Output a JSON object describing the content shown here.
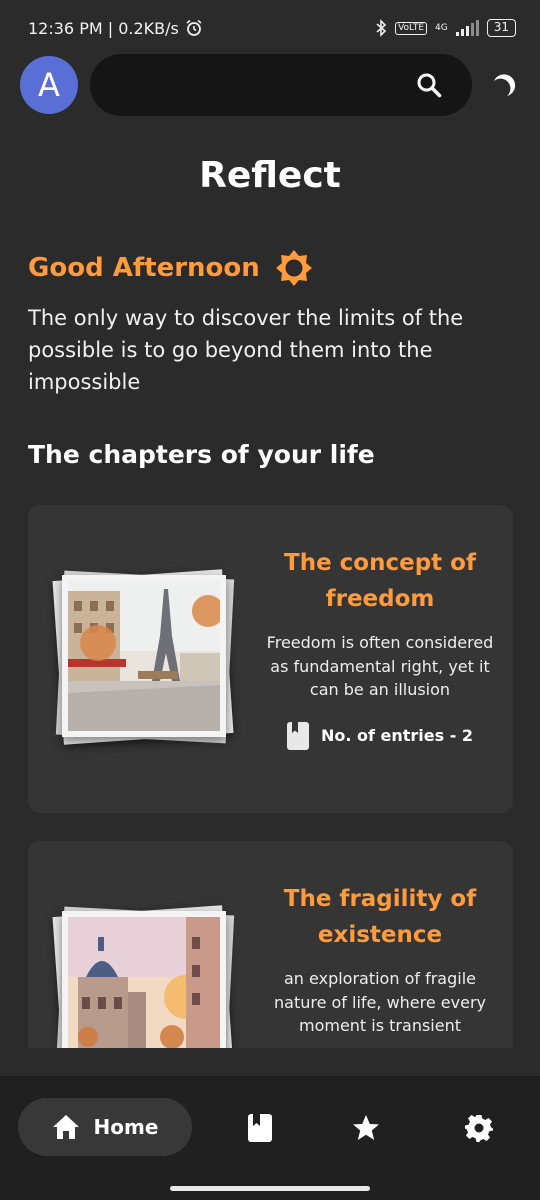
{
  "status_bar": {
    "time_speed": "12:36 PM | 0.2KB/s",
    "alarm_icon": "alarm-icon",
    "bluetooth_icon": "bluetooth-icon",
    "volte": "VoLTE",
    "network": "4G",
    "battery": "31"
  },
  "top_bar": {
    "avatar_letter": "A",
    "search_placeholder": "",
    "search_icon": "search-icon",
    "theme_icon": "moon-icon"
  },
  "page": {
    "title": "Reflect",
    "greeting": "Good Afternoon",
    "greeting_icon": "sun-icon",
    "quote": "The only way to discover the limits of the possible is to go beyond them into the impossible",
    "section_title": "The chapters of your life"
  },
  "chapters": [
    {
      "title": "The concept of freedom",
      "description": "Freedom is often considered as fundamental right, yet it can be an illusion",
      "entries": "No. of entries - 2",
      "image_icon": "paris-eiffel-watercolor"
    },
    {
      "title": "The fragility of existence",
      "description": "an exploration of fragile nature of life, where every moment is transient",
      "image_icon": "paris-street-watercolor"
    }
  ],
  "bottom_nav": {
    "home_label": "Home",
    "icons": [
      "home-icon",
      "journal-icon",
      "star-icon",
      "settings-icon"
    ]
  },
  "colors": {
    "accent": "#ff9a3d",
    "background": "#2b2b2b",
    "card": "#353535",
    "avatar": "#5a6fd6"
  }
}
